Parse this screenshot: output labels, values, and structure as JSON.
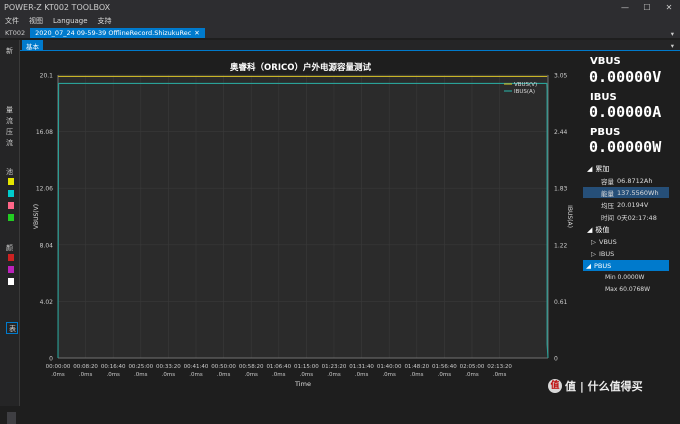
{
  "app": {
    "title": "POWER-Z KT002 TOOLBOX",
    "min_glyph": "—",
    "max_glyph": "☐",
    "close_glyph": "✕"
  },
  "menu": [
    "文件",
    "视图",
    "Language",
    "支持"
  ],
  "tabs": {
    "device": "KT002",
    "record": "2020_07_24 09-59-39 OfflineRecord.ShizukuRec",
    "close_glyph": "✕",
    "dropdown_glyph": "▾"
  },
  "subtab": {
    "label": "基本"
  },
  "left_panel": {
    "labels": [
      "新",
      "量",
      "流",
      "压",
      "流",
      "池",
      "电流",
      "绘",
      "颜",
      "表"
    ]
  },
  "chart_data": {
    "type": "line",
    "title": "奥睿科（ORICO）户外电源容量测试",
    "xlabel": "Time",
    "ylabel_left": "VBUS(V)",
    "ylabel_right": "IBUS(A)",
    "ylim_left": [
      0,
      20.1
    ],
    "ylim_right": [
      0,
      3.05
    ],
    "yticks_left": [
      "0",
      "4.02",
      "8.04",
      "12.06",
      "16.08",
      "20.1"
    ],
    "yticks_right": [
      "0",
      "0.61",
      "1.22",
      "1.83",
      "2.44",
      "3.05"
    ],
    "xticks_top": [
      "00:00:00",
      "00:08:20",
      "00:16:40",
      "00:25:00",
      "00:33:20",
      "00:41:40",
      "00:50:00",
      "00:58:20",
      "01:06:40",
      "01:15:00",
      "01:23:20",
      "01:31:40",
      "01:40:00",
      "01:48:20",
      "01:56:40",
      "02:05:00",
      "02:13:20"
    ],
    "xtick_unit": ".0ms",
    "x_seconds_max": 8877,
    "legend": [
      "VBUS(V)",
      "IBUS(A)"
    ],
    "legend_position": "top-right",
    "grid": true,
    "series": [
      {
        "name": "VBUS(V)",
        "color": "#c8b428",
        "points": [
          [
            0,
            20.0
          ],
          [
            8860,
            20.0
          ],
          [
            8862,
            20.0
          ]
        ]
      },
      {
        "name": "IBUS(A)",
        "color": "#2aa198",
        "points": [
          [
            0,
            0.0
          ],
          [
            10,
            2.96
          ],
          [
            8855,
            2.96
          ],
          [
            8860,
            2.9
          ],
          [
            8861,
            0.15
          ],
          [
            8877,
            0.0
          ]
        ]
      }
    ]
  },
  "readout": {
    "vbus_label": "VBUS",
    "vbus_value": "0.00000V",
    "ibus_label": "IBUS",
    "ibus_value": "0.00000A",
    "pbus_label": "PBUS",
    "pbus_value": "0.00000W"
  },
  "accumulate": {
    "title": "累加",
    "rows": [
      {
        "k": "容量",
        "v": "06.8712Ah"
      },
      {
        "k": "能量",
        "v": "137.5560Wh"
      },
      {
        "k": "均压",
        "v": "20.0194V"
      },
      {
        "k": "时间",
        "v": "0天02:17:48"
      }
    ]
  },
  "extremes": {
    "title": "极值",
    "items": [
      "VBUS",
      "IBUS",
      "PBUS"
    ],
    "pbus_min": "Min 0.0000W",
    "pbus_max": "Max 60.0768W"
  },
  "watermark": {
    "text": "值 | 什么值得买",
    "logo_glyph": "值"
  },
  "colors": {
    "accent": "#007acc",
    "vbus": "#c8b428",
    "ibus": "#2aa198",
    "grid": "#3a3a3a"
  }
}
